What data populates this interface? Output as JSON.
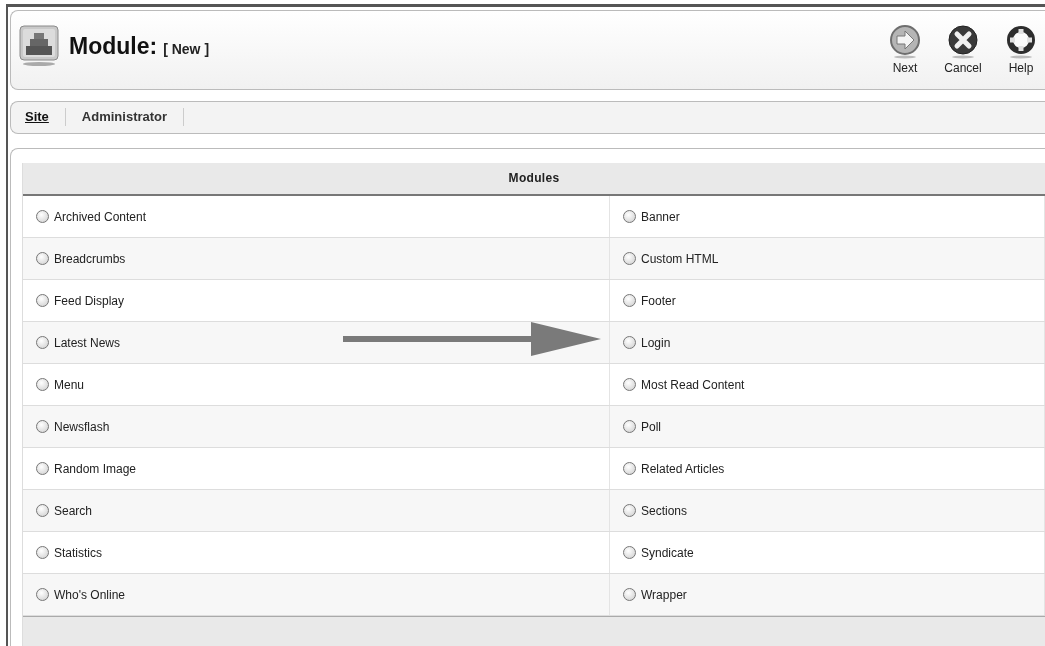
{
  "header": {
    "title": "Module:",
    "subtitle": "[ New ]"
  },
  "toolbar": [
    {
      "kind": "next",
      "label": "Next"
    },
    {
      "kind": "cancel",
      "label": "Cancel"
    },
    {
      "kind": "help",
      "label": "Help"
    }
  ],
  "tabs": [
    {
      "label": "Site",
      "selected": true
    },
    {
      "label": "Administrator",
      "selected": false
    }
  ],
  "table": {
    "heading": "Modules",
    "rows": [
      [
        {
          "label": "Archived Content",
          "selected": false
        },
        {
          "label": "Banner",
          "selected": false
        }
      ],
      [
        {
          "label": "Breadcrumbs",
          "selected": false
        },
        {
          "label": "Custom HTML",
          "selected": false
        }
      ],
      [
        {
          "label": "Feed Display",
          "selected": false
        },
        {
          "label": "Footer",
          "selected": false
        }
      ],
      [
        {
          "label": "Latest News",
          "selected": false
        },
        {
          "label": "Login",
          "selected": false
        }
      ],
      [
        {
          "label": "Menu",
          "selected": false
        },
        {
          "label": "Most Read Content",
          "selected": false
        }
      ],
      [
        {
          "label": "Newsflash",
          "selected": false
        },
        {
          "label": "Poll",
          "selected": false
        }
      ],
      [
        {
          "label": "Random Image",
          "selected": false
        },
        {
          "label": "Related Articles",
          "selected": false
        }
      ],
      [
        {
          "label": "Search",
          "selected": false
        },
        {
          "label": "Sections",
          "selected": false
        }
      ],
      [
        {
          "label": "Statistics",
          "selected": false
        },
        {
          "label": "Syndicate",
          "selected": false
        }
      ],
      [
        {
          "label": "Who's Online",
          "selected": false
        },
        {
          "label": "Wrapper",
          "selected": false
        }
      ]
    ]
  }
}
